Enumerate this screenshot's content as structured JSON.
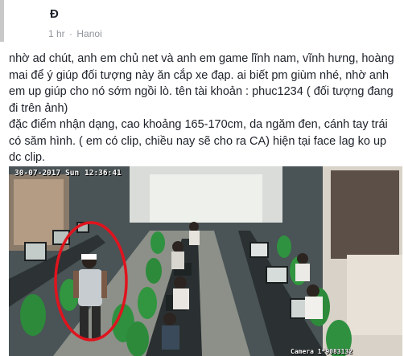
{
  "post": {
    "author_name": "Đ",
    "time": "1 hr",
    "separator": "·",
    "location": "Hanoi",
    "paragraphs": [
      "nhờ ad chút, anh em chủ net và anh em game lĩnh nam, vĩnh hưng, hoàng mai để ý giúp đối tượng này ăn cắp xe đạp. ai biết pm giùm nhé, nhờ anh em up giúp cho nó sớm ngồi lò. tên tài khoản : phuc1234 ( đối tượng đang đi trên ảnh)",
      "đặc điểm nhận dạng, cao khoảng 165-170cm, da ngăm đen, cánh tay trái có săm hình. ( em có clip, chiều nay sẽ cho ra CA) hiện tại face lag ko up dc clip."
    ]
  },
  "cctv": {
    "date": "30-07-2017",
    "day": "Sun",
    "time": "12:36:41",
    "camera_label": "Camera 1*9083132",
    "highlight_color": "#e0141e"
  }
}
